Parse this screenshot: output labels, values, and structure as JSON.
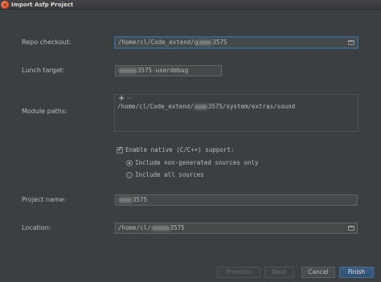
{
  "window": {
    "title": "Import Asfp Project",
    "close_glyph": "×"
  },
  "repo_checkout": {
    "label": "Repo checkout:",
    "value_prefix": "/home/cl/Code_extend/g",
    "value_suffix": "3575"
  },
  "lunch_target": {
    "label": "Lunch target:",
    "value_suffix": "3575-userdebug"
  },
  "module_paths": {
    "label": "Module paths:",
    "add_glyph": "+",
    "remove_glyph": "−",
    "items": [
      {
        "prefix": "/home/cl/Code_extend/",
        "suffix": "3575/system/extras/sound"
      }
    ]
  },
  "native_support": {
    "checkbox_label": "Enable native (C/C++) support:",
    "checked": true,
    "options": [
      {
        "label": "Include non-generated sources only",
        "selected": true
      },
      {
        "label": "Include all sources",
        "selected": false
      }
    ]
  },
  "project_name": {
    "label": "Project name:",
    "value_suffix": "3575"
  },
  "location": {
    "label": "Location:",
    "value_prefix": "/home/cl/",
    "value_suffix": "3575"
  },
  "buttons": {
    "previous": "Previous",
    "next": "Next",
    "cancel": "Cancel",
    "finish": "Finish"
  },
  "colors": {
    "background": "#3c3f41",
    "focus_border": "#3d6185",
    "primary_button": "#365880"
  }
}
